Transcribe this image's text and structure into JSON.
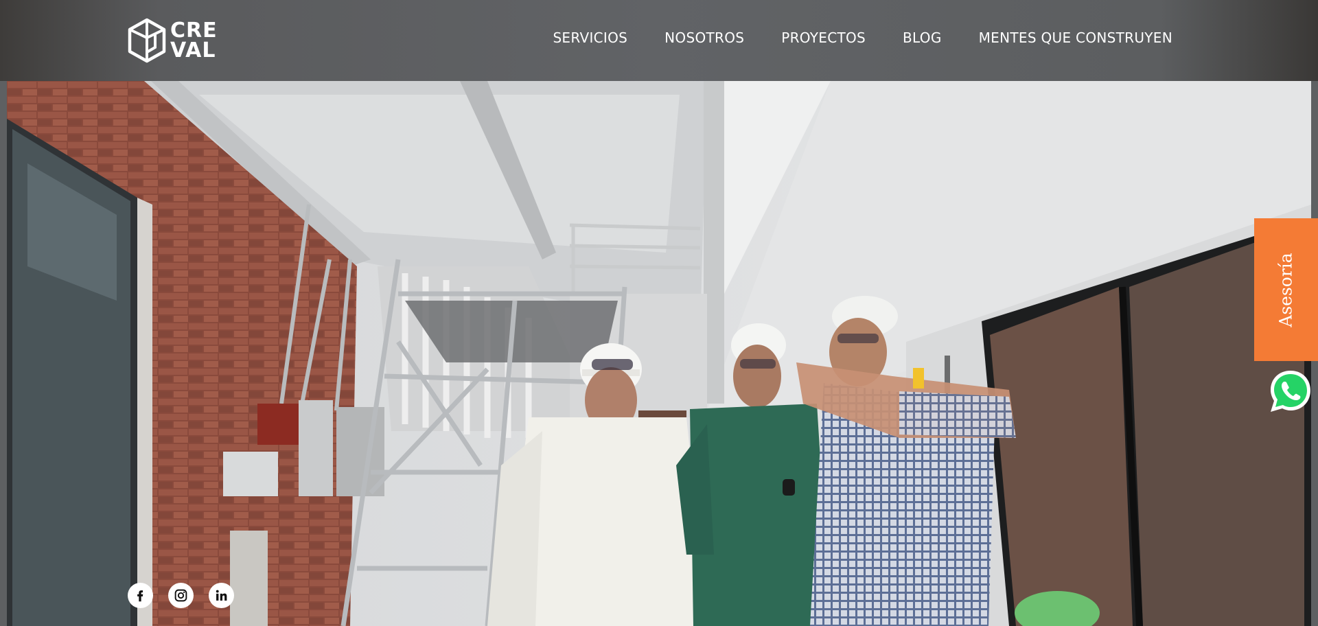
{
  "brand": {
    "logo_text_line1": "CRE",
    "logo_text_line2": "VAL"
  },
  "nav": {
    "items": [
      {
        "label": "SERVICIOS"
      },
      {
        "label": "NOSOTROS"
      },
      {
        "label": "PROYECTOS"
      },
      {
        "label": "BLOG"
      },
      {
        "label": "MENTES QUE CONSTRUYEN"
      }
    ]
  },
  "floating": {
    "asesoria_label": "Asesoría",
    "whatsapp_icon": "whatsapp-icon"
  },
  "socials": [
    {
      "icon": "facebook-icon"
    },
    {
      "icon": "instagram-icon"
    },
    {
      "icon": "linkedin-icon"
    }
  ],
  "colors": {
    "header_bg": "#616366",
    "accent_orange": "#f47b35",
    "whatsapp_green": "#25d366",
    "text_white": "#ffffff"
  }
}
